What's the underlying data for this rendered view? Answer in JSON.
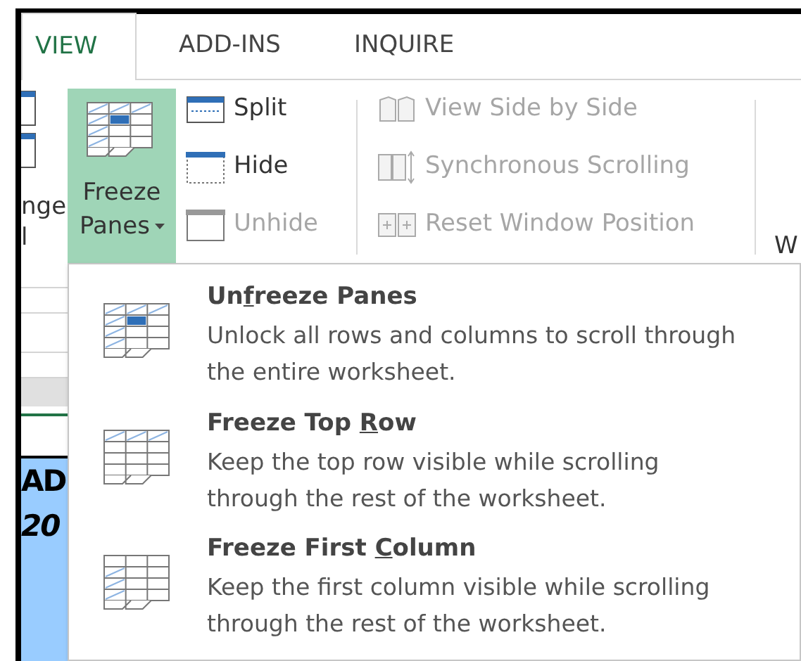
{
  "tabs": [
    {
      "label": "VIEW",
      "selected": true
    },
    {
      "label": "ADD-INS",
      "selected": false
    },
    {
      "label": "INQUIRE",
      "selected": false
    }
  ],
  "ribbon": {
    "left_partial_label": [
      "nge",
      "l"
    ],
    "freeze_button": {
      "label_top": "Freeze",
      "label_bottom": "Panes",
      "open": true
    },
    "window_group": [
      {
        "kind": "split",
        "label": "Split",
        "disabled": false
      },
      {
        "kind": "hide",
        "label": "Hide",
        "disabled": false
      },
      {
        "kind": "unhide",
        "label": "Unhide",
        "disabled": true
      }
    ],
    "compare_group": [
      {
        "kind": "side",
        "label": "View Side by Side",
        "disabled": true
      },
      {
        "kind": "sync",
        "label": "Synchronous Scrolling",
        "disabled": true
      },
      {
        "kind": "reset",
        "label": "Reset Window Position",
        "disabled": true
      }
    ],
    "right_partial_label": "W"
  },
  "sheet": {
    "cell_texts": [
      "AD",
      "20"
    ]
  },
  "menu": [
    {
      "kind": "unfreeze",
      "title_before": "Un",
      "access_key": "f",
      "title_after": "reeze Panes",
      "description": "Unlock all rows and columns to scroll through the entire worksheet."
    },
    {
      "kind": "top_row",
      "title_before": "Freeze Top ",
      "access_key": "R",
      "title_after": "ow",
      "description": "Keep the top row visible while scrolling through the rest of the worksheet."
    },
    {
      "kind": "first_column",
      "title_before": "Freeze First ",
      "access_key": "C",
      "title_after": "olumn",
      "description": "Keep the first column visible while scrolling through the rest of the worksheet."
    }
  ]
}
